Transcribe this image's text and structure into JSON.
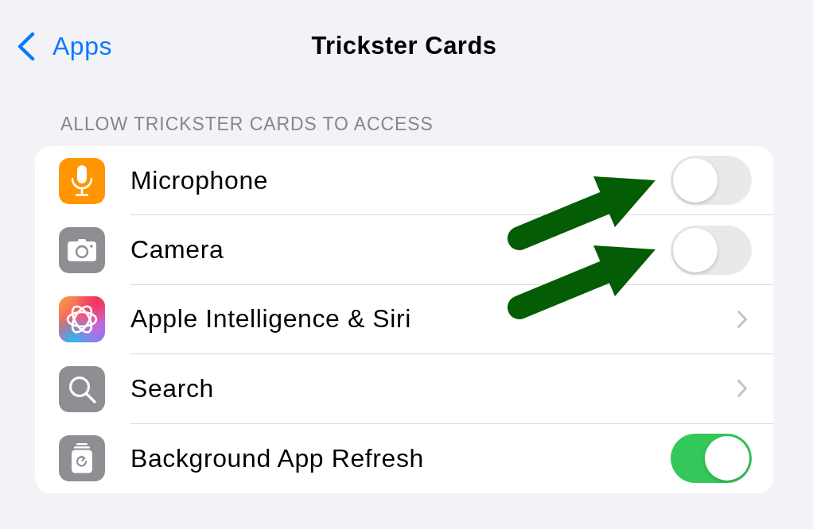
{
  "nav": {
    "back_label": "Apps",
    "title": "Trickster Cards"
  },
  "section": {
    "header": "ALLOW TRICKSTER CARDS TO ACCESS",
    "rows": [
      {
        "kind": "toggle",
        "label": "Microphone",
        "on": false,
        "arrow": true
      },
      {
        "kind": "toggle",
        "label": "Camera",
        "on": false,
        "arrow": true
      },
      {
        "kind": "link",
        "label": "Apple Intelligence & Siri",
        "arrow": false
      },
      {
        "kind": "link",
        "label": "Search",
        "arrow": false
      },
      {
        "kind": "toggle",
        "label": "Background App Refresh",
        "on": true,
        "arrow": false
      }
    ]
  }
}
